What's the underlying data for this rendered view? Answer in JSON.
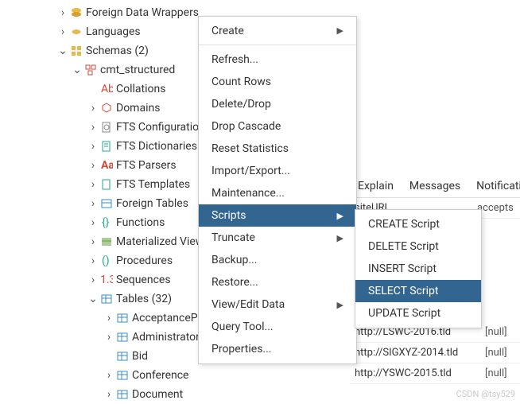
{
  "tree": {
    "fdw": "Foreign Data Wrappers",
    "languages": "Languages",
    "schemas": "Schemas (2)",
    "schema": "cmt_structured",
    "collations": "Collations",
    "domains": "Domains",
    "fts_config": "FTS Configurations",
    "fts_dict": "FTS Dictionaries",
    "fts_parsers": "FTS Parsers",
    "fts_templ": "FTS Templates",
    "foreign_tables": "Foreign Tables",
    "functions": "Functions",
    "materialized": "Materialized Views",
    "procedures": "Procedures",
    "sequences": "Sequences",
    "tables": "Tables (32)",
    "t_accept": "AcceptancePhase",
    "t_admin": "Administrator",
    "t_bid": "Bid",
    "t_confere": "Conference",
    "t_document": "Document"
  },
  "menu": {
    "create": "Create",
    "refresh": "Refresh...",
    "count_rows": "Count Rows",
    "delete": "Delete/Drop",
    "drop_cascade": "Drop Cascade",
    "reset_stats": "Reset Statistics",
    "import_export": "Import/Export...",
    "maintenance": "Maintenance...",
    "scripts": "Scripts",
    "truncate": "Truncate",
    "backup": "Backup...",
    "restore": "Restore...",
    "view_edit": "View/Edit Data",
    "query_tool": "Query Tool...",
    "properties": "Properties..."
  },
  "submenu": {
    "create": "CREATE Script",
    "delete": "DELETE Script",
    "insert": "INSERT Script",
    "select": "SELECT Script",
    "update": "UPDATE Script"
  },
  "tabs": {
    "explain": "Explain",
    "messages": "Messages",
    "notif": "Notifications"
  },
  "grid": {
    "r1": {
      "url": "http://LSWC-2016.tld",
      "n": "[null]"
    },
    "r2": {
      "url": "http://SIGXYZ-2014.tld",
      "n": "[null]"
    },
    "r3": {
      "url": "http://YSWC-2015.tld",
      "n": "[null]"
    },
    "r4": {
      "url": "siteURL",
      "n": "accepts"
    }
  },
  "watermark": "CSDN @tsy529"
}
